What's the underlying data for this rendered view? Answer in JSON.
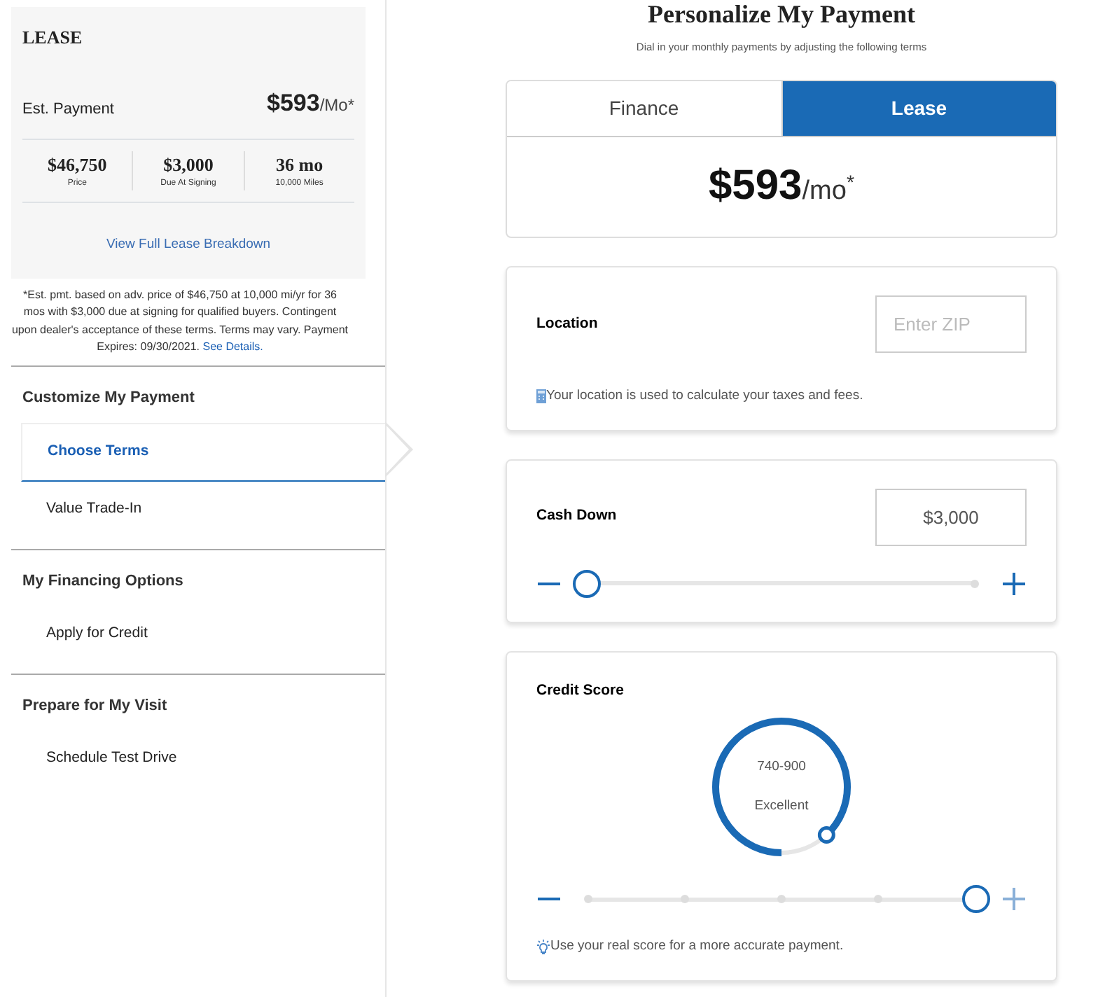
{
  "summary": {
    "title": "LEASE",
    "est_label": "Est. Payment",
    "est_amount": "$593",
    "est_unit": "/Mo*",
    "stats": [
      {
        "value": "$46,750",
        "label": "Price"
      },
      {
        "value": "$3,000",
        "label": "Due At Signing"
      },
      {
        "value": "36 mo",
        "label": "10,000 Miles"
      }
    ],
    "breakdown_link": "View Full Lease Breakdown"
  },
  "disclaimer": {
    "text": "*Est. pmt. based on adv. price of $46,750 at 10,000 mi/yr for 36 mos with $3,000 due at signing for qualified buyers. Contingent upon dealer's acceptance of these terms. Terms may vary. Payment Expires: 09/30/2021.",
    "link": "See Details."
  },
  "nav": [
    {
      "heading": "Customize My Payment",
      "items": [
        {
          "label": "Choose Terms",
          "selected": true
        },
        {
          "label": "Value Trade-In",
          "selected": false
        }
      ]
    },
    {
      "heading": "My Financing Options",
      "items": [
        {
          "label": "Apply for Credit",
          "selected": false
        }
      ]
    },
    {
      "heading": "Prepare for My Visit",
      "items": [
        {
          "label": "Schedule Test Drive",
          "selected": false
        }
      ]
    }
  ],
  "header": {
    "title": "Personalize My Payment",
    "subtitle": "Dial in your monthly payments by adjusting the following terms"
  },
  "tabs": [
    {
      "label": "Finance",
      "selected": false
    },
    {
      "label": "Lease",
      "selected": true
    }
  ],
  "payment": {
    "amount": "$593",
    "unit": "/mo$^{*}$"
  },
  "location": {
    "label": "Location",
    "placeholder": "Enter ZIP",
    "note": "Your location is used to calculate your taxes and fees."
  },
  "cash_down": {
    "label": "Cash Down",
    "value": "$3,000",
    "level": 0
  },
  "credit_score": {
    "label": "Credit Score",
    "range": "740-900",
    "rating": "Excellent",
    "gauge": {
      "level": 0.88
    },
    "slider": {
      "level": 1
    },
    "note": "Use your real score for a more accurate payment."
  }
}
